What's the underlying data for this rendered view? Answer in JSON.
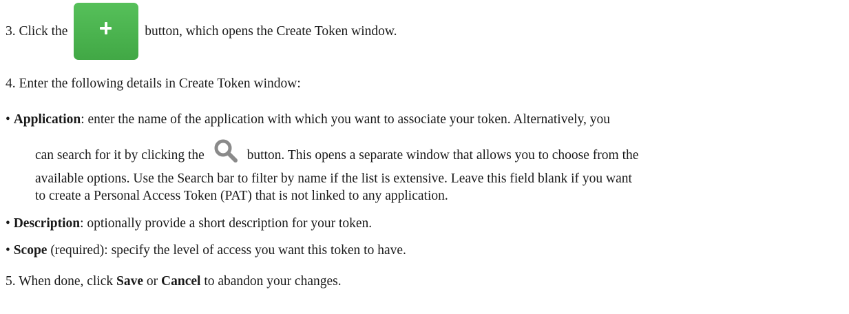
{
  "steps": {
    "step3": {
      "number": "3.",
      "before": "Click the",
      "after": "button, which opens the Create Token window.",
      "button_icon": "plus-icon",
      "button_color": "#4CB550"
    },
    "step4": {
      "number": "4.",
      "text": "Enter the following details in Create Token window:"
    },
    "bullets": {
      "application": {
        "bullet": "•",
        "term": "Application",
        "line1": ": enter the name of the application with which you want to associate your token. Alternatively, you",
        "line2_before": "can search for it by clicking the",
        "line2_after": "button. This opens a separate window that allows you to choose from the",
        "line3": "available options. Use the Search bar to filter by name if the list is extensive. Leave this field blank if you want",
        "line4": "to create a Personal Access Token (PAT) that is not linked to any application.",
        "button_icon": "search-icon",
        "button_color": "#8a8a8a"
      },
      "description": {
        "bullet": "•",
        "term": "Description",
        "text": ": optionally provide a short description for your token."
      },
      "scope": {
        "bullet": "•",
        "term": "Scope",
        "text": " (required): specify the level of access you want this token to have."
      }
    },
    "step5": {
      "number": "5.",
      "before": "When done, click",
      "save": "Save",
      "middle": "or",
      "cancel": "Cancel",
      "after": "to abandon your changes."
    }
  }
}
